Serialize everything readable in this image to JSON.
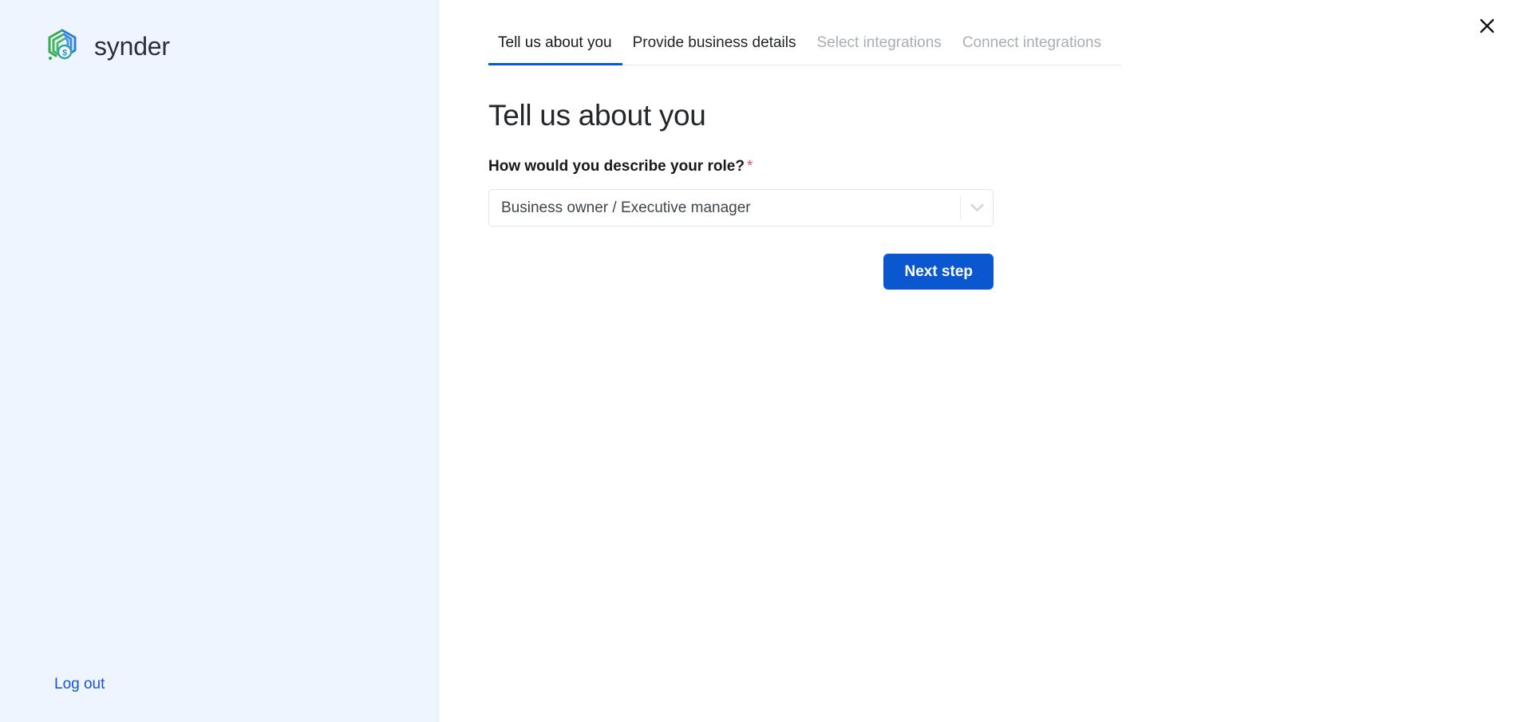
{
  "sidebar": {
    "brand_name": "synder",
    "logo_icon": "synder-hexagon-logo",
    "logout_label": "Log out"
  },
  "header": {
    "close_icon": "close-icon"
  },
  "tabs": [
    {
      "label": "Tell us about you",
      "state": "active"
    },
    {
      "label": "Provide business details",
      "state": "enabled"
    },
    {
      "label": "Select integrations",
      "state": "disabled"
    },
    {
      "label": "Connect integrations",
      "state": "disabled"
    }
  ],
  "main": {
    "page_title": "Tell us about you",
    "field": {
      "label": "How would you describe your role?",
      "required_marker": "*",
      "selected_value": "Business owner / Executive manager",
      "chevron_icon": "chevron-down-icon"
    },
    "next_button_label": "Next step"
  },
  "colors": {
    "accent_blue": "#0b57d0",
    "sidebar_bg": "#eff5fe",
    "required_red": "#e8536a",
    "disabled_text": "#a9aeb5",
    "link_blue": "#1452d6"
  }
}
